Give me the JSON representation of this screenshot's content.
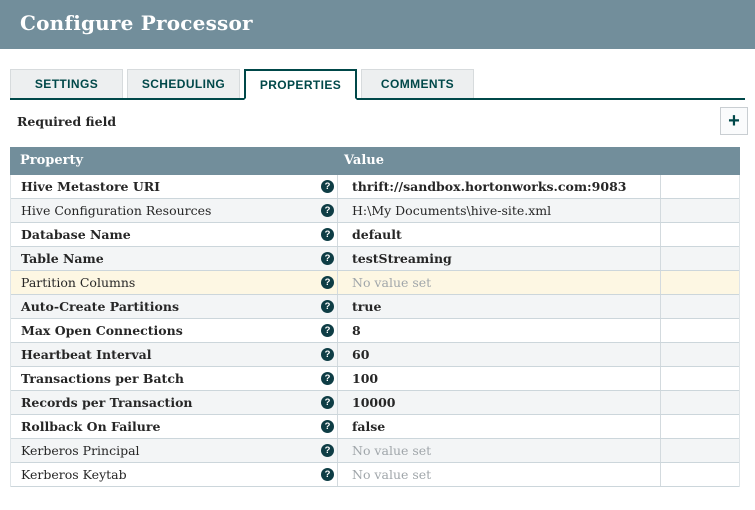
{
  "dialog": {
    "title": "Configure Processor"
  },
  "tabs": [
    {
      "label": "SETTINGS",
      "active": false
    },
    {
      "label": "SCHEDULING",
      "active": false
    },
    {
      "label": "PROPERTIES",
      "active": true
    },
    {
      "label": "COMMENTS",
      "active": false
    }
  ],
  "toolbar": {
    "required_field_label": "Required field",
    "add_button_glyph": "+"
  },
  "properties_table": {
    "columns": [
      {
        "label": "Property"
      },
      {
        "label": "Value"
      }
    ],
    "help_icon_glyph": "?",
    "no_value_text": "No value set",
    "rows": [
      {
        "property": "Hive Metastore URI",
        "value": "thrift://sandbox.hortonworks.com:9083",
        "required": true,
        "value_set": true,
        "highlighted": false
      },
      {
        "property": "Hive Configuration Resources",
        "value": "H:\\My Documents\\hive-site.xml",
        "required": false,
        "value_set": true,
        "highlighted": false
      },
      {
        "property": "Database Name",
        "value": "default",
        "required": true,
        "value_set": true,
        "highlighted": false
      },
      {
        "property": "Table Name",
        "value": "testStreaming",
        "required": true,
        "value_set": true,
        "highlighted": false
      },
      {
        "property": "Partition Columns",
        "value": "No value set",
        "required": false,
        "value_set": false,
        "highlighted": true
      },
      {
        "property": "Auto-Create Partitions",
        "value": "true",
        "required": true,
        "value_set": true,
        "highlighted": false
      },
      {
        "property": "Max Open Connections",
        "value": "8",
        "required": true,
        "value_set": true,
        "highlighted": false
      },
      {
        "property": "Heartbeat Interval",
        "value": "60",
        "required": true,
        "value_set": true,
        "highlighted": false
      },
      {
        "property": "Transactions per Batch",
        "value": "100",
        "required": true,
        "value_set": true,
        "highlighted": false
      },
      {
        "property": "Records per Transaction",
        "value": "10000",
        "required": true,
        "value_set": true,
        "highlighted": false
      },
      {
        "property": "Rollback On Failure",
        "value": "false",
        "required": true,
        "value_set": true,
        "highlighted": false
      },
      {
        "property": "Kerberos Principal",
        "value": "No value set",
        "required": false,
        "value_set": false,
        "highlighted": false
      },
      {
        "property": "Kerberos Keytab",
        "value": "No value set",
        "required": false,
        "value_set": false,
        "highlighted": false
      }
    ]
  },
  "colors": {
    "header_bg": "#728e9b",
    "accent_teal": "#004849",
    "tab_inactive_bg": "#edeff0",
    "row_alt_bg": "#f3f5f6",
    "row_highlight_bg": "#fdf7e3",
    "row_border": "#ccd6db",
    "unset_text": "#a0a6aa",
    "text": "#262626"
  }
}
